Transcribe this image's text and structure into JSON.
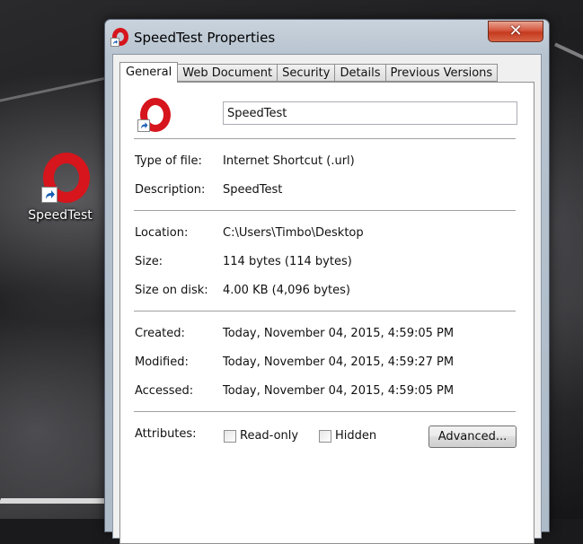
{
  "desktop": {
    "icon_label": "SpeedTest",
    "icon_name": "opera-shortcut-icon"
  },
  "window": {
    "title": "SpeedTest Properties",
    "close_symbol": "✕",
    "tabs": [
      {
        "label": "General",
        "active": true
      },
      {
        "label": "Web Document",
        "active": false
      },
      {
        "label": "Security",
        "active": false
      },
      {
        "label": "Details",
        "active": false
      },
      {
        "label": "Previous Versions",
        "active": false
      }
    ]
  },
  "general": {
    "file_name": "SpeedTest",
    "type_of_file": {
      "label": "Type of file:",
      "value": "Internet Shortcut (.url)"
    },
    "description": {
      "label": "Description:",
      "value": "SpeedTest"
    },
    "location": {
      "label": "Location:",
      "value": "C:\\Users\\Timbo\\Desktop"
    },
    "size": {
      "label": "Size:",
      "value": "114 bytes (114 bytes)"
    },
    "size_on_disk": {
      "label": "Size on disk:",
      "value": "4.00 KB (4,096 bytes)"
    },
    "created": {
      "label": "Created:",
      "value": "Today, November 04, 2015, 4:59:05 PM"
    },
    "modified": {
      "label": "Modified:",
      "value": "Today, November 04, 2015, 4:59:27 PM"
    },
    "accessed": {
      "label": "Accessed:",
      "value": "Today, November 04, 2015, 4:59:05 PM"
    },
    "attributes": {
      "label": "Attributes:",
      "read_only": {
        "label": "Read-only",
        "checked": false
      },
      "hidden": {
        "label": "Hidden",
        "checked": false
      },
      "advanced_button": "Advanced..."
    }
  },
  "colors": {
    "opera_red": "#d6151c",
    "close_red": "#c43a1f",
    "shortcut_arrow": "#1a5fb4"
  }
}
